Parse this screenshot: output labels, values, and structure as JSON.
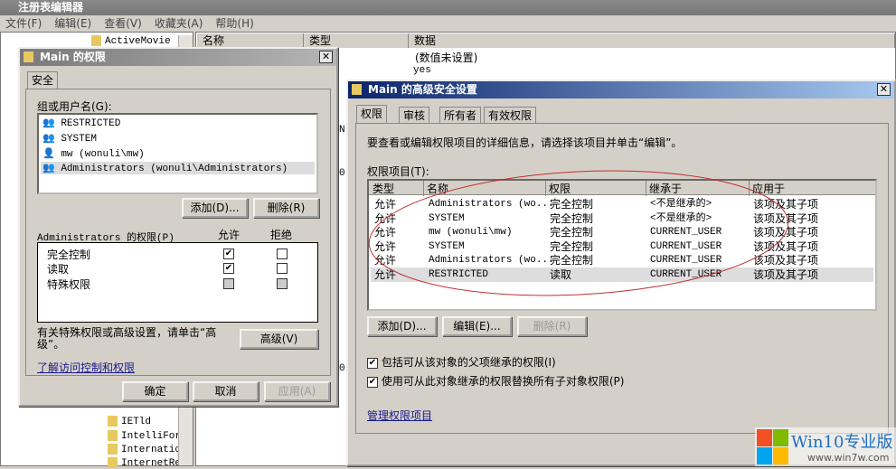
{
  "app": {
    "title": "注册表编辑器",
    "menu": [
      "文件(F)",
      "编辑(E)",
      "查看(V)",
      "收藏夹(A)",
      "帮助(H)"
    ]
  },
  "tree": {
    "items": [
      "ActiveMovie",
      "IETld",
      "IntelliFor",
      "Internatic",
      "InternetRe"
    ]
  },
  "list": {
    "headers": [
      "名称",
      "类型",
      "数据"
    ],
    "data": [
      "(数值未设置)",
      "yes"
    ],
    "fragments": [
      "N",
      "0",
      "0"
    ]
  },
  "perm_dialog": {
    "title": "Main 的权限",
    "tab": "安全",
    "group_label": "组或用户名(G):",
    "users": [
      "RESTRICTED",
      "SYSTEM",
      "mw (wonuli\\mw)",
      "Administrators (wonuli\\Administrators)"
    ],
    "add": "添加(D)...",
    "remove": "删除(R)",
    "perm_label": "Administrators 的权限(P)",
    "allow": "允许",
    "deny": "拒绝",
    "perms": [
      {
        "name": "完全控制",
        "allow": true,
        "deny": false
      },
      {
        "name": "读取",
        "allow": true,
        "deny": false
      },
      {
        "name": "特殊权限",
        "allow": false,
        "deny": false
      }
    ],
    "advanced_text": "有关特殊权限或高级设置，请单击“高级”。",
    "advanced": "高级(V)",
    "learn_link": "了解访问控制和权限",
    "ok": "确定",
    "cancel": "取消",
    "apply": "应用(A)"
  },
  "adv_dialog": {
    "title": "Main 的高级安全设置",
    "tabs": [
      "权限",
      "审核",
      "所有者",
      "有效权限"
    ],
    "description": "要查看或编辑权限项目的详细信息，请选择该项目并单击“编辑”。",
    "entries_label": "权限项目(T):",
    "columns": [
      "类型",
      "名称",
      "权限",
      "继承于",
      "应用于"
    ],
    "rows": [
      [
        "允许",
        "Administrators (wo...",
        "完全控制",
        "<不是继承的>",
        "该项及其子项"
      ],
      [
        "允许",
        "SYSTEM",
        "完全控制",
        "<不是继承的>",
        "该项及其子项"
      ],
      [
        "允许",
        "mw (wonuli\\mw)",
        "完全控制",
        "CURRENT_USER",
        "该项及其子项"
      ],
      [
        "允许",
        "SYSTEM",
        "完全控制",
        "CURRENT_USER",
        "该项及其子项"
      ],
      [
        "允许",
        "Administrators (wo...",
        "完全控制",
        "CURRENT_USER",
        "该项及其子项"
      ],
      [
        "允许",
        "RESTRICTED",
        "读取",
        "CURRENT_USER",
        "该项及其子项"
      ]
    ],
    "add": "添加(D)...",
    "edit": "编辑(E)...",
    "remove": "删除(R)",
    "check1": "包括可从该对象的父项继承的权限(I)",
    "check2": "使用可从此对象继承的权限替换所有子对象权限(P)",
    "manage_link": "管理权限项目"
  },
  "watermark": {
    "brand": "Win10专业版",
    "url": "www.win7w.com"
  }
}
